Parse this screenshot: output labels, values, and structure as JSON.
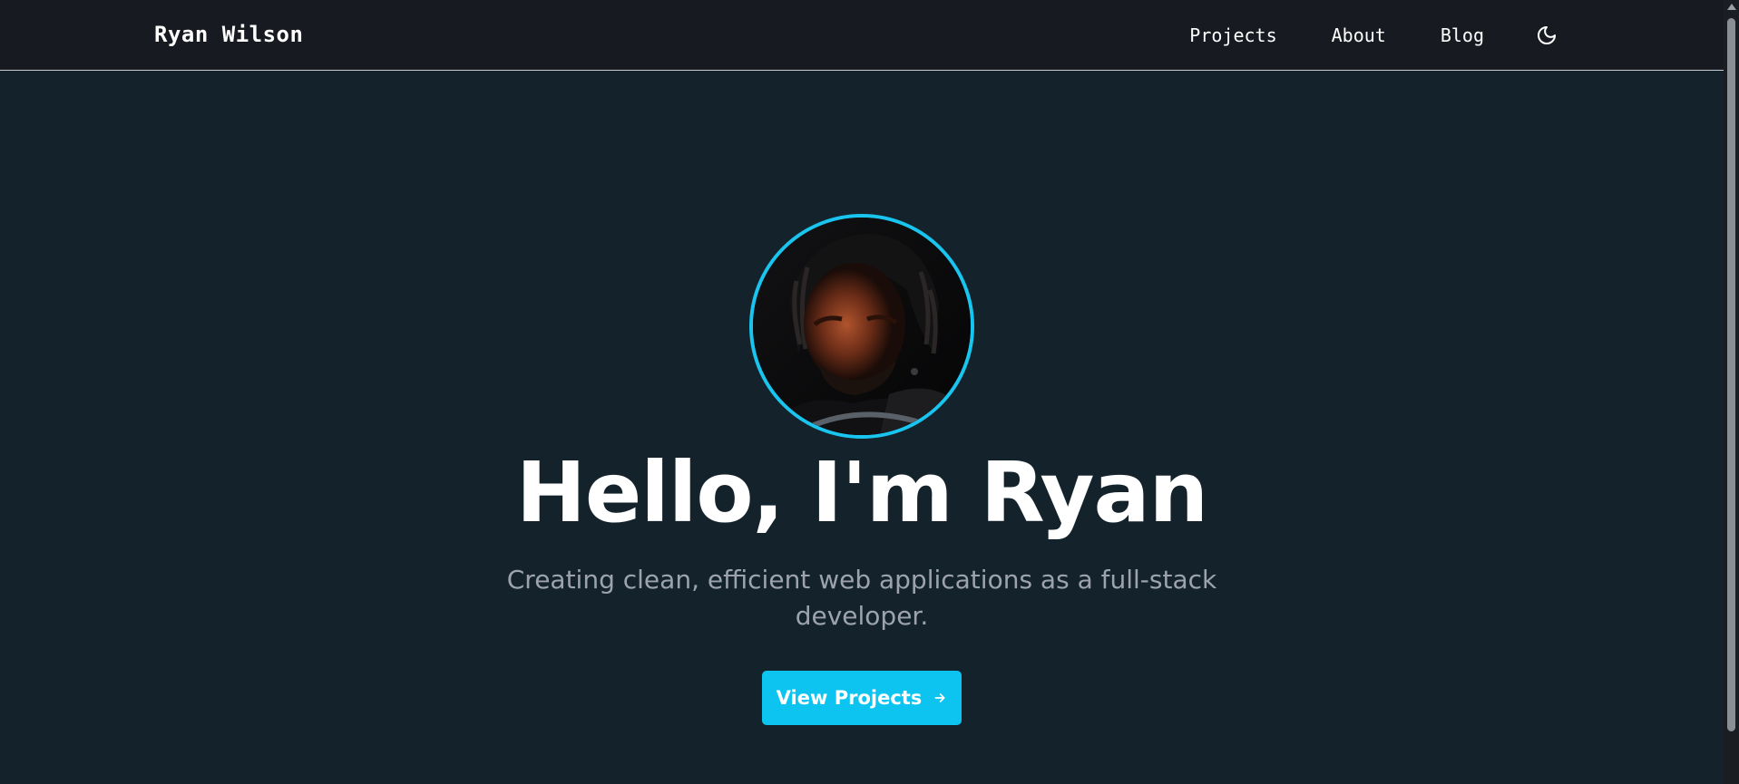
{
  "header": {
    "brand": "Ryan Wilson",
    "nav": [
      {
        "label": "Projects"
      },
      {
        "label": "About"
      },
      {
        "label": "Blog"
      }
    ],
    "theme_toggle_icon": "moon-icon"
  },
  "hero": {
    "avatar_alt": "avatar",
    "headline": "Hello, I'm Ryan",
    "subtitle_line1": "Creating clean, efficient web applications as a full-stack",
    "subtitle_line2": "developer.",
    "cta_label": "View Projects",
    "cta_icon": "arrow-right-icon"
  },
  "colors": {
    "background": "#14232b",
    "navbar": "#171a20",
    "accent": "#0cc4ef",
    "subtitle": "#9ca3af"
  }
}
